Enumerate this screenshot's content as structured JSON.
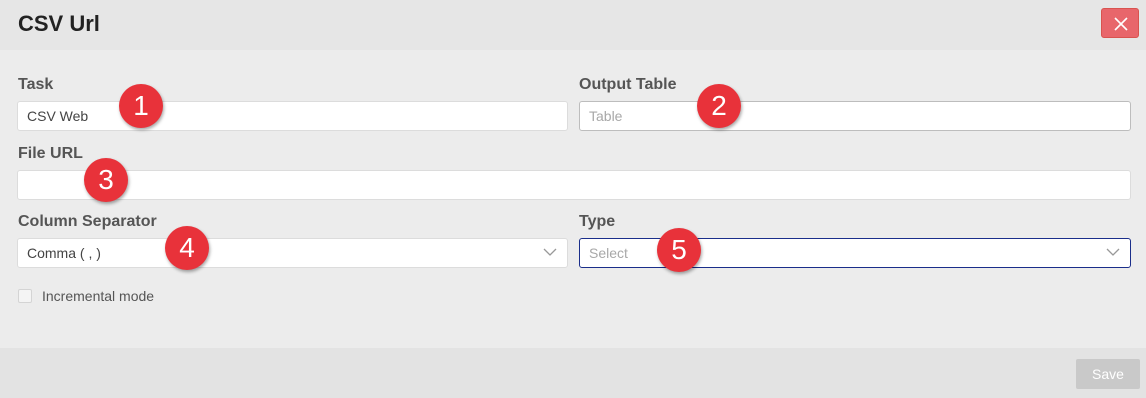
{
  "dialog": {
    "title": "CSV Url",
    "close_icon": "close-icon"
  },
  "form": {
    "task": {
      "label": "Task",
      "value": "CSV Web"
    },
    "output_table": {
      "label": "Output Table",
      "placeholder": "Table"
    },
    "file_url": {
      "label": "File URL",
      "value": ""
    },
    "column_separator": {
      "label": "Column Separator",
      "value": "Comma ( , )"
    },
    "type": {
      "label": "Type",
      "placeholder": "Select"
    },
    "incremental_mode": {
      "label": "Incremental mode",
      "checked": false
    }
  },
  "annotations": [
    "1",
    "2",
    "3",
    "4",
    "5"
  ],
  "footer": {
    "save_label": "Save"
  },
  "colors": {
    "badge": "#e8323a",
    "close_button": "#e8666b",
    "focus_border": "#1a2e8a",
    "save_disabled": "#c9c9c9"
  }
}
